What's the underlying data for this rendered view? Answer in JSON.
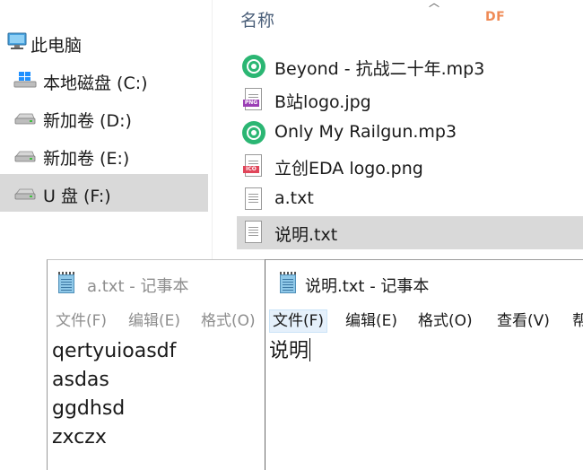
{
  "explorer": {
    "nav": [
      {
        "label": "此电脑",
        "icon": "computer-icon"
      },
      {
        "label": "本地磁盘 (C:)",
        "icon": "windows-drive-icon"
      },
      {
        "label": "新加卷 (D:)",
        "icon": "drive-icon"
      },
      {
        "label": "新加卷 (E:)",
        "icon": "drive-icon"
      },
      {
        "label": "U 盘 (F:)",
        "icon": "usb-drive-icon",
        "selected": true
      }
    ],
    "column_header": "名称",
    "brand_mark": "DF",
    "files": [
      {
        "name": "Beyond - 抗战二十年.mp3",
        "icon": "music-file-icon"
      },
      {
        "name": "B站logo.jpg",
        "icon": "image-file-icon",
        "badge": "PNG"
      },
      {
        "name": "Only My Railgun.mp3",
        "icon": "music-file-icon"
      },
      {
        "name": "立创EDA logo.png",
        "icon": "image-file-icon",
        "badge": "ICO"
      },
      {
        "name": "a.txt",
        "icon": "text-file-icon"
      },
      {
        "name": "说明.txt",
        "icon": "text-file-icon",
        "selected": true
      }
    ]
  },
  "notepad_a": {
    "title": "a.txt - 记事本",
    "menu": [
      "文件(F)",
      "编辑(E)",
      "格式(O)"
    ],
    "content": "qertyuioasdf\nasdas\nggdhsd\nzxczx"
  },
  "notepad_b": {
    "title": "说明.txt - 记事本",
    "menu": [
      "文件(F)",
      "编辑(E)",
      "格式(O)",
      "查看(V)",
      "帮"
    ],
    "content": "说明"
  },
  "colors": {
    "selection": "#d9d9d9",
    "music_icon": "#2bb673",
    "header_text": "#4c607a",
    "brand": "#ef8a55"
  }
}
